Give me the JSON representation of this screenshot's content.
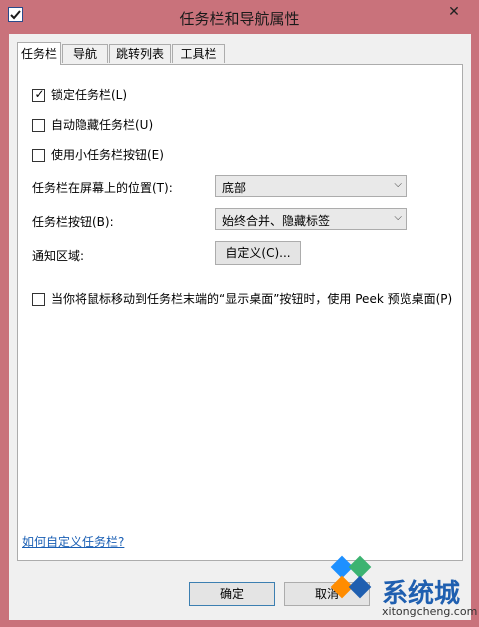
{
  "window": {
    "title": "任务栏和导航属性",
    "close_glyph": "✕"
  },
  "tabs": [
    {
      "label": "任务栏",
      "active": true
    },
    {
      "label": "导航",
      "active": false
    },
    {
      "label": "跳转列表",
      "active": false
    },
    {
      "label": "工具栏",
      "active": false
    }
  ],
  "options": {
    "lock_taskbar": {
      "label": "锁定任务栏(L)",
      "checked": true
    },
    "auto_hide": {
      "label": "自动隐藏任务栏(U)",
      "checked": false
    },
    "small_buttons": {
      "label": "使用小任务栏按钮(E)",
      "checked": false
    },
    "peek": {
      "label": "当你将鼠标移动到任务栏末端的“显示桌面”按钮时，使用 Peek 预览桌面(P)",
      "checked": false
    }
  },
  "fields": {
    "location_label": "任务栏在屏幕上的位置(T):",
    "location_value": "底部",
    "buttons_label": "任务栏按钮(B):",
    "buttons_value": "始终合并、隐藏标签",
    "notify_label": "通知区域:",
    "customize_button": "自定义(C)..."
  },
  "link": {
    "label": "如何自定义任务栏?"
  },
  "footer": {
    "ok_label": "确定",
    "cancel_label": "取消"
  },
  "watermark": {
    "text": "系统城",
    "url": "xitongcheng.com",
    "colors": [
      "#1e90ff",
      "#3cb371",
      "#ff8c00",
      "#1f5fb0"
    ]
  }
}
